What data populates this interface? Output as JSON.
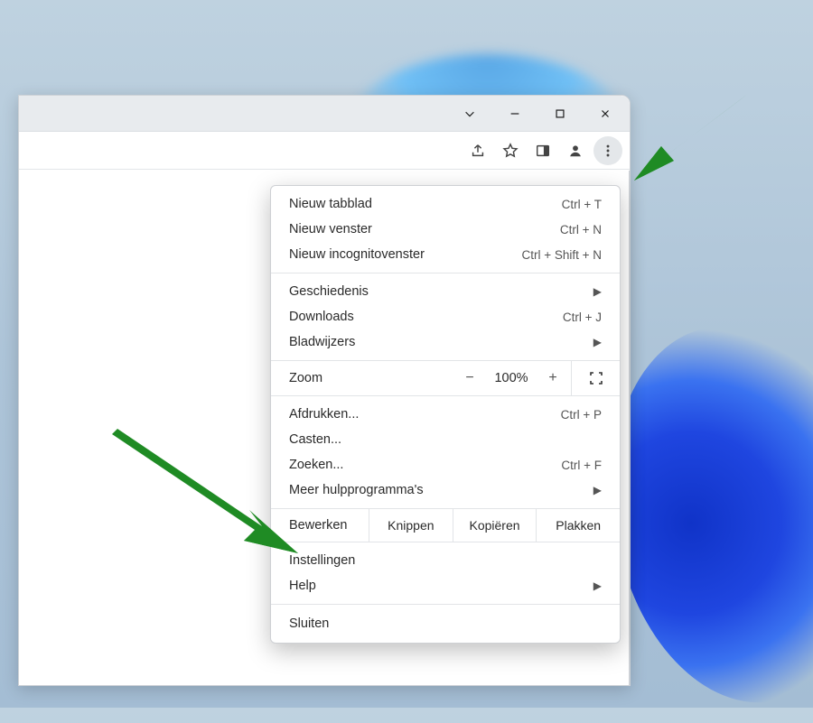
{
  "menu": {
    "new_tab": {
      "label": "Nieuw tabblad",
      "shortcut": "Ctrl + T"
    },
    "new_window": {
      "label": "Nieuw venster",
      "shortcut": "Ctrl + N"
    },
    "new_incognito": {
      "label": "Nieuw incognitovenster",
      "shortcut": "Ctrl + Shift + N"
    },
    "history": {
      "label": "Geschiedenis"
    },
    "downloads": {
      "label": "Downloads",
      "shortcut": "Ctrl + J"
    },
    "bookmarks": {
      "label": "Bladwijzers"
    },
    "zoom": {
      "label": "Zoom",
      "value": "100%"
    },
    "print": {
      "label": "Afdrukken...",
      "shortcut": "Ctrl + P"
    },
    "cast": {
      "label": "Casten..."
    },
    "find": {
      "label": "Zoeken...",
      "shortcut": "Ctrl + F"
    },
    "more_tools": {
      "label": "Meer hulpprogramma's"
    },
    "edit": {
      "label": "Bewerken",
      "cut": "Knippen",
      "copy": "Kopiëren",
      "paste": "Plakken"
    },
    "settings": {
      "label": "Instellingen"
    },
    "help": {
      "label": "Help"
    },
    "exit": {
      "label": "Sluiten"
    }
  }
}
